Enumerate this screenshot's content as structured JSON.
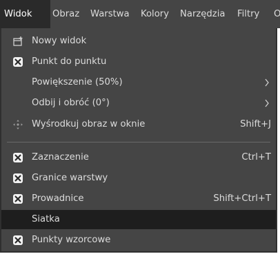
{
  "menubar": {
    "items": [
      {
        "label": "Widok",
        "active": true
      },
      {
        "label": "Obraz"
      },
      {
        "label": "Warstwa"
      },
      {
        "label": "Kolory"
      },
      {
        "label": "Narzędzia"
      },
      {
        "label": "Filtry"
      },
      {
        "label": "O"
      }
    ]
  },
  "menu": {
    "items": [
      {
        "label": "Nowy widok",
        "icon": "new-view-icon"
      },
      {
        "label": "Punkt do punktu",
        "checked": true
      },
      {
        "label": "Powiększenie (50%)",
        "submenu": true
      },
      {
        "label": "Odbij i obróć (0°)",
        "submenu": true
      },
      {
        "label": "Wyśrodkuj obraz w oknie",
        "icon": "center-image-icon",
        "shortcut": "Shift+J"
      },
      {
        "label": "Zaznaczenie",
        "checked": true,
        "shortcut": "Ctrl+T"
      },
      {
        "label": "Granice warstwy",
        "checked": true
      },
      {
        "label": "Prowadnice",
        "checked": true,
        "shortcut": "Shift+Ctrl+T"
      },
      {
        "label": "Siatka",
        "checked": false,
        "highlighted": true
      },
      {
        "label": "Punkty wzorcowe",
        "checked": true
      }
    ]
  },
  "colors": {
    "background": "#454545",
    "text": "#dcdcdc",
    "highlight": "#1e1e1e",
    "active_menubar": "#2a2a2a"
  }
}
